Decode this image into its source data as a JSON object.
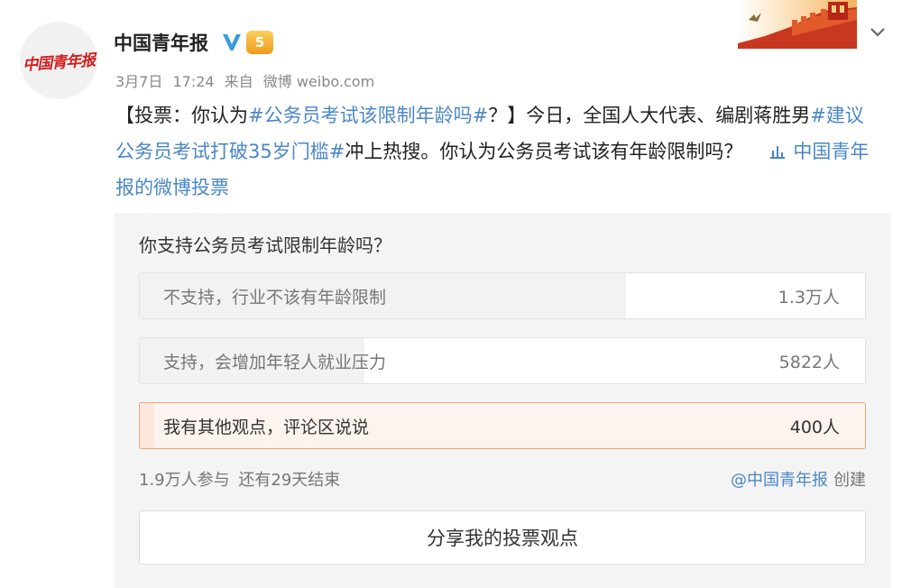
{
  "post": {
    "author": "中国青年报",
    "avatar_text": "中国青年报",
    "vip_badge": "5",
    "date": "3月7日",
    "time": "17:24",
    "source_prefix": "来自",
    "source": "微博 weibo.com",
    "text": {
      "part1": "【投票：你认为",
      "topic1": "#公务员考试该限制年龄吗#",
      "part2": "？】今日，全国人大代表、编剧蒋胜男",
      "topic2": "#建议公务员考试打破35岁门槛#",
      "part3": "冲上热搜。你认为公务员考试该有年龄限制吗？",
      "vote_link": "中国青年报的微博投票"
    }
  },
  "poll": {
    "question": "你支持公务员考试限制年龄吗？",
    "options": [
      {
        "label": "不支持，行业不该有年龄限制",
        "count": "1.3万人",
        "share": 0.67
      },
      {
        "label": "支持，会增加年轻人就业压力",
        "count": "5822人",
        "share": 0.31
      },
      {
        "label": "我有其他观点，评论区说说",
        "count": "400人",
        "share": 0.02,
        "selected": true
      }
    ],
    "participants": "1.9万人参与",
    "remaining": "还有29天结束",
    "creator": "@中国青年报",
    "creator_suffix": "创建",
    "share_button": "分享我的投票观点"
  },
  "colors": {
    "link": "#4a87c8",
    "selected_border": "#f3a477",
    "avatar_red": "#d21f1f",
    "verified": "#3b9bdc",
    "vip": "#f19a1c"
  },
  "icons": [
    "verified-icon",
    "vip-icon",
    "poll-icon",
    "chevron-down-icon",
    "great-wall-banner"
  ]
}
